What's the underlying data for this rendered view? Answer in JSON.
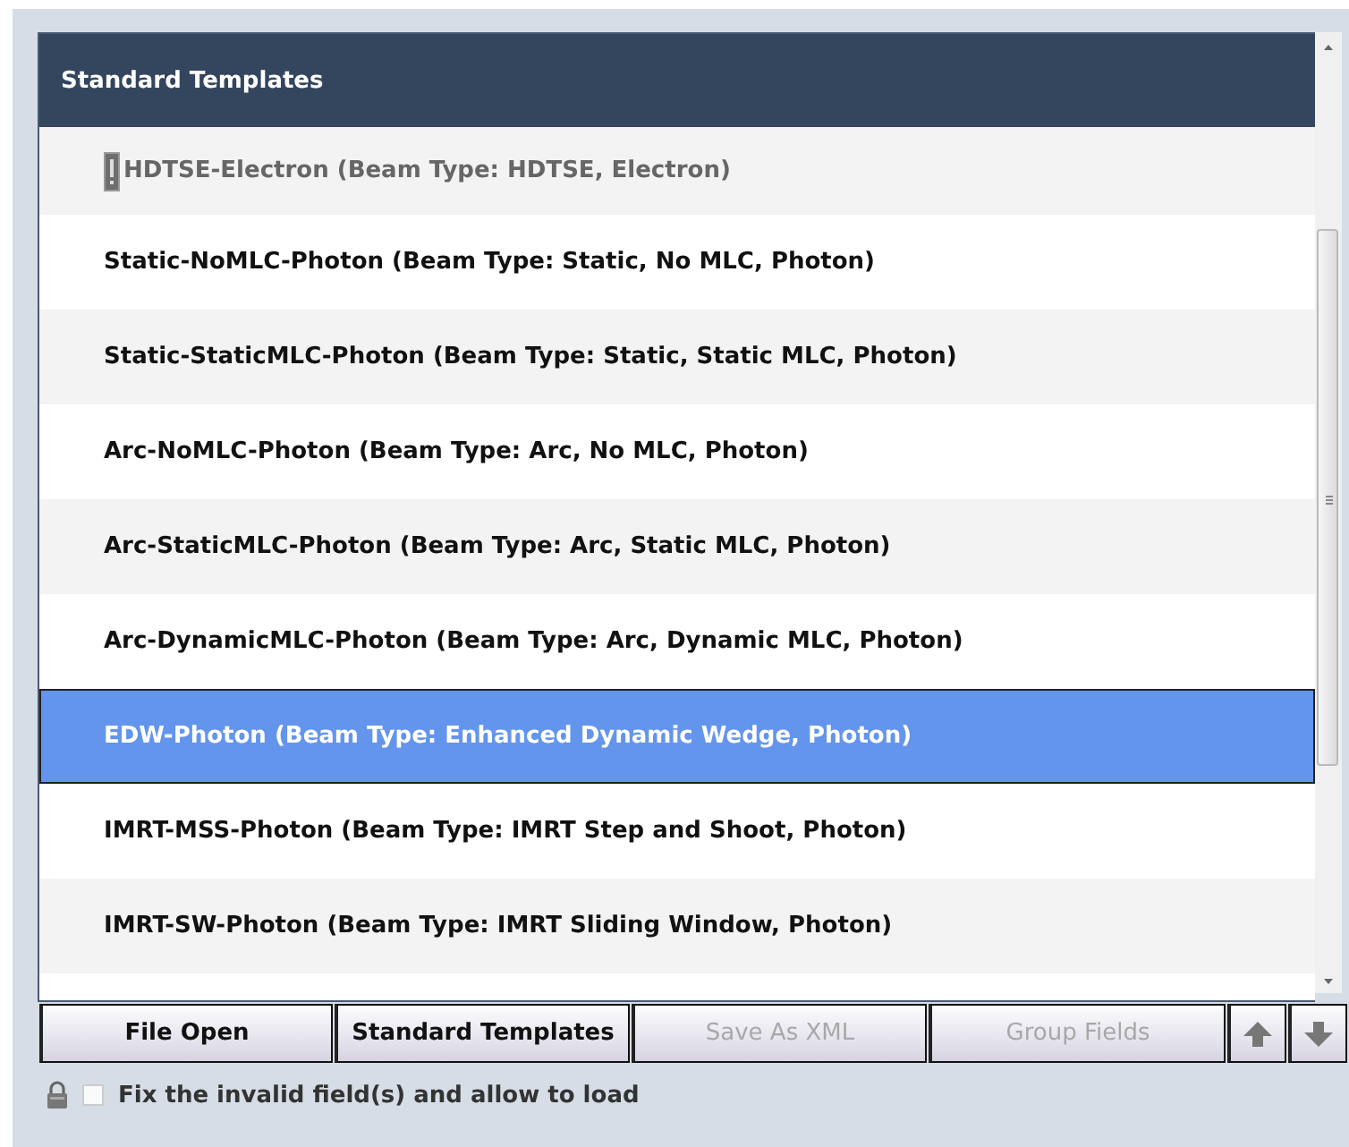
{
  "panel": {
    "title": "Standard Templates"
  },
  "templates": [
    {
      "label": "HDTSE-Electron (Beam Type: HDTSE, Electron)",
      "invalid": true,
      "selected": false
    },
    {
      "label": "Static-NoMLC-Photon (Beam Type: Static, No MLC, Photon)",
      "invalid": false,
      "selected": false
    },
    {
      "label": "Static-StaticMLC-Photon (Beam Type: Static, Static MLC, Photon)",
      "invalid": false,
      "selected": false
    },
    {
      "label": "Arc-NoMLC-Photon (Beam Type: Arc, No MLC, Photon)",
      "invalid": false,
      "selected": false
    },
    {
      "label": "Arc-StaticMLC-Photon (Beam Type: Arc, Static MLC, Photon)",
      "invalid": false,
      "selected": false
    },
    {
      "label": "Arc-DynamicMLC-Photon (Beam Type: Arc, Dynamic MLC, Photon)",
      "invalid": false,
      "selected": false
    },
    {
      "label": "EDW-Photon (Beam Type: Enhanced Dynamic Wedge, Photon)",
      "invalid": false,
      "selected": true
    },
    {
      "label": "IMRT-MSS-Photon (Beam Type: IMRT Step and Shoot, Photon)",
      "invalid": false,
      "selected": false
    },
    {
      "label": "IMRT-SW-Photon (Beam Type: IMRT Sliding Window, Photon)",
      "invalid": false,
      "selected": false
    }
  ],
  "buttons": [
    {
      "kind": "text",
      "label": "File Open",
      "disabled": false
    },
    {
      "kind": "text",
      "label": "Standard Templates",
      "disabled": false
    },
    {
      "kind": "text",
      "label": "Save As XML",
      "disabled": true
    },
    {
      "kind": "text",
      "label": "Group Fields",
      "disabled": true
    },
    {
      "kind": "up",
      "disabled": false
    },
    {
      "kind": "down",
      "disabled": false
    }
  ],
  "fix_option": {
    "label": "Fix the invalid field(s) and allow to load",
    "checked": false
  }
}
